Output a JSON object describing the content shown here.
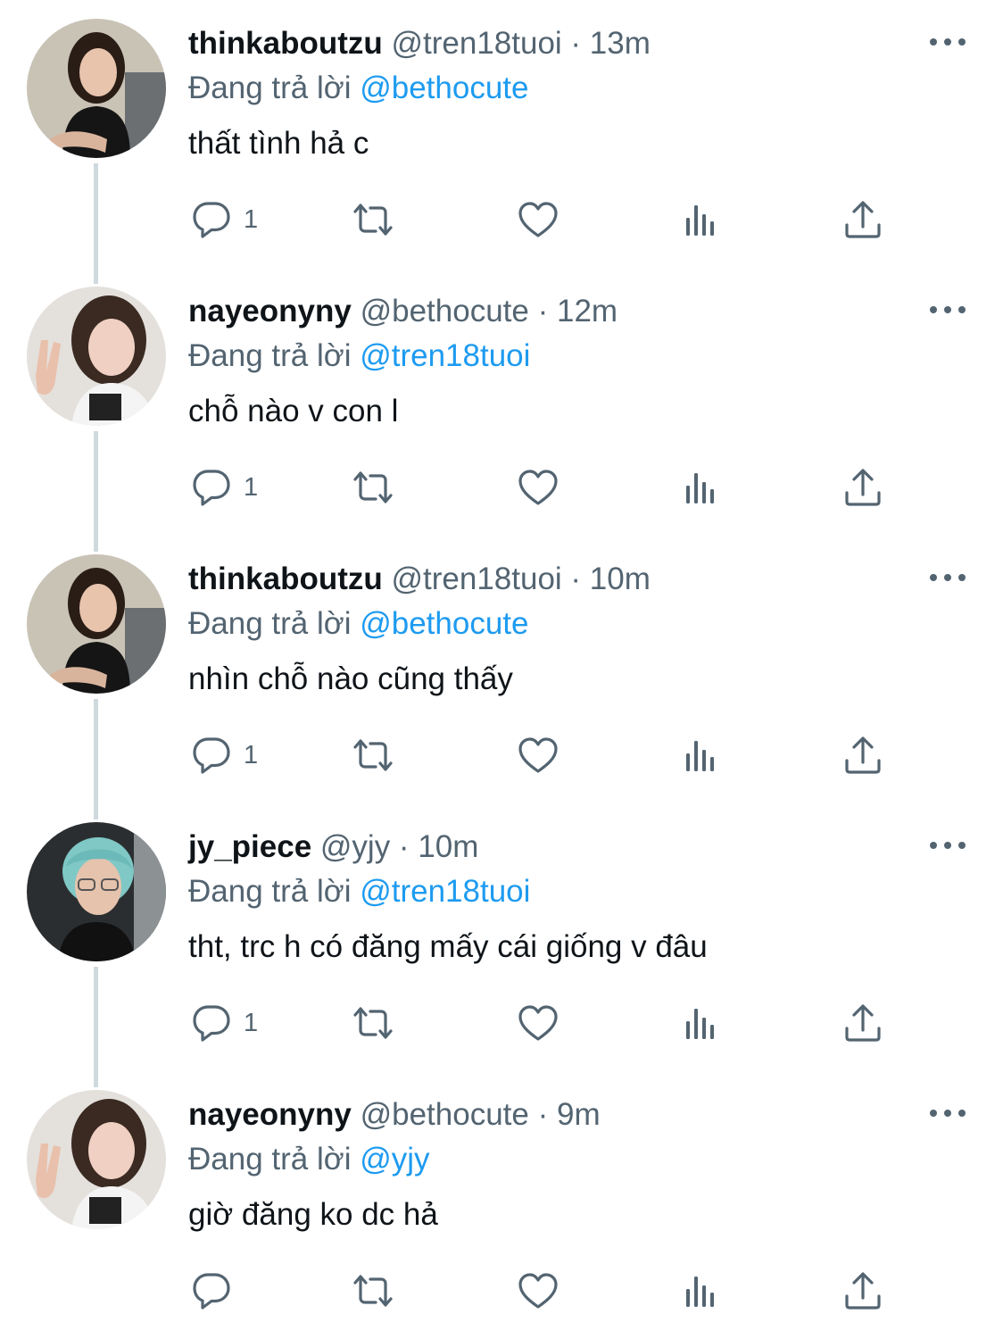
{
  "colors": {
    "text": "#0f1419",
    "secondary": "#536471",
    "mention": "#1d9bf0",
    "thread_line": "#cfd9de"
  },
  "tweets": [
    {
      "display_name": "thinkaboutzu",
      "handle": "@tren18tuoi",
      "separator": " · ",
      "time": "13m",
      "reply_label": "Đang trả lời ",
      "reply_to": "@bethocute",
      "text": "thất tình hả c",
      "reply_count": "1",
      "avatar": "avatar-woman-dark-hair"
    },
    {
      "display_name": "nayeonyny",
      "handle": "@bethocute",
      "separator": " · ",
      "time": "12m",
      "reply_label": "Đang trả lời ",
      "reply_to": "@tren18tuoi",
      "text": "chỗ nào v con l",
      "reply_count": "1",
      "avatar": "avatar-woman-peace-sign"
    },
    {
      "display_name": "thinkaboutzu",
      "handle": "@tren18tuoi",
      "separator": " · ",
      "time": "10m",
      "reply_label": "Đang trả lời ",
      "reply_to": "@bethocute",
      "text": "nhìn chỗ nào cũng thấy",
      "reply_count": "1",
      "avatar": "avatar-woman-dark-hair"
    },
    {
      "display_name": "jy_piece",
      "handle": "@yjy",
      "separator": " · ",
      "time": "10m",
      "reply_label": "Đang trả lời ",
      "reply_to": "@tren18tuoi",
      "text": "tht, trc h có đăng mấy cái giống v đâu",
      "reply_count": "1",
      "avatar": "avatar-person-blue-hair"
    },
    {
      "display_name": "nayeonyny",
      "handle": "@bethocute",
      "separator": " · ",
      "time": "9m",
      "reply_label": "Đang trả lời ",
      "reply_to": "@yjy",
      "text": "giờ đăng ko dc hả",
      "reply_count": "",
      "avatar": "avatar-woman-peace-sign"
    }
  ]
}
